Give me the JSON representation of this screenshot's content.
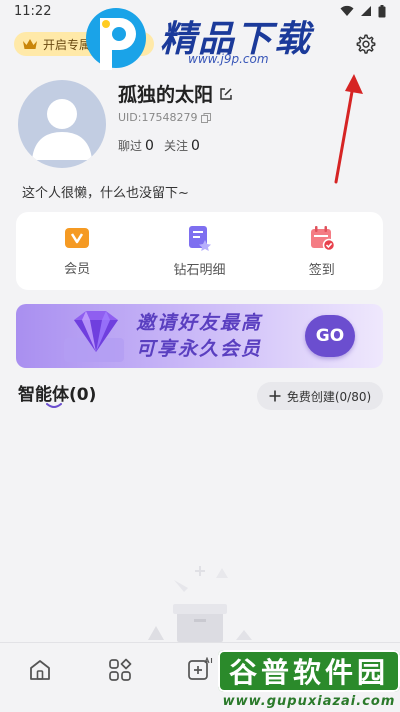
{
  "status_bar": {
    "time": "11:22"
  },
  "watermark_top": {
    "title": "精品下载",
    "url": "www.j9p.com"
  },
  "vip_banner": {
    "label": "开启专属会员权益"
  },
  "profile": {
    "username": "孤独的太阳",
    "uid": "UID:17548279",
    "chats_label": "聊过",
    "chats_count": "0",
    "follow_label": "关注",
    "follow_count": "0",
    "bio": "这个人很懒，什么也没留下~"
  },
  "quick_actions": [
    {
      "label": "会员",
      "icon": "vip-icon"
    },
    {
      "label": "钻石明细",
      "icon": "diamond-detail-icon"
    },
    {
      "label": "签到",
      "icon": "checkin-calendar-icon"
    }
  ],
  "invite_banner": {
    "line1": "邀请好友最高",
    "line2": "可享永久会员",
    "button": "GO"
  },
  "agents": {
    "title": "智能体(0)",
    "create_label": "免费创建(0/80)"
  },
  "bottom_nav": [
    {
      "icon": "home-icon"
    },
    {
      "icon": "grid-apps-icon"
    },
    {
      "icon": "ai-create-icon"
    }
  ],
  "watermark_bottom": {
    "title": "谷普软件园",
    "url": "www.gupuxiazai.com"
  },
  "colors": {
    "accent": "#6b4ecf",
    "banner_start": "#a98ff0",
    "vip_banner_bg": "#ffe9a8",
    "annotation_arrow": "#d62424"
  }
}
